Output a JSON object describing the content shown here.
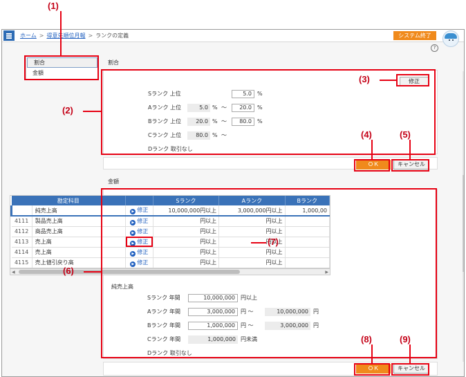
{
  "header": {
    "breadcrumb": [
      {
        "label": "ホーム",
        "link": true
      },
      {
        "label": "得意先順位月報",
        "link": true
      },
      {
        "label": "ランクの定義",
        "link": false
      }
    ],
    "separator": ">",
    "system_exit": "システム終了",
    "help": "?"
  },
  "nav": {
    "items": [
      "割合",
      "金額"
    ],
    "active": 0
  },
  "ratio": {
    "title": "割合",
    "edit": "修正",
    "ok": "ＯＫ",
    "cancel": "キャンセル",
    "unit": "%",
    "tilde": "～",
    "rows": [
      {
        "label": "Sランク 上位",
        "from": null,
        "to": "5.0"
      },
      {
        "label": "Aランク 上位",
        "from": "5.0",
        "to": "20.0"
      },
      {
        "label": "Bランク 上位",
        "from": "20.0",
        "to": "80.0"
      },
      {
        "label": "Cランク 上位",
        "from": "80.0",
        "to": null
      },
      {
        "label": "Dランク 取引なし"
      }
    ]
  },
  "amount": {
    "title": "金額",
    "table": {
      "headers": [
        "勘定科目",
        "Sランク",
        "Aランク",
        "Bランク"
      ],
      "edit_label": "修正",
      "rows": [
        {
          "code": "",
          "name": "純売上高",
          "s": "10,000,000円以上",
          "a": "3,000,000円以上",
          "b": "1,000,00"
        },
        {
          "code": "4111",
          "name": "製品売上高",
          "s": "円以上",
          "a": "円以上",
          "b": ""
        },
        {
          "code": "4112",
          "name": "商品売上高",
          "s": "円以上",
          "a": "円以上",
          "b": ""
        },
        {
          "code": "4113",
          "name": "売上高",
          "s": "円以上",
          "a": "円以上",
          "b": ""
        },
        {
          "code": "4114",
          "name": "売上高",
          "s": "円以上",
          "a": "円以上",
          "b": ""
        },
        {
          "code": "4115",
          "name": "売上値引戻り高",
          "s": "円以上",
          "a": "円以上",
          "b": ""
        }
      ]
    },
    "detail": {
      "title": "純売上高",
      "rows": [
        {
          "label": "Sランク 年間",
          "from": "10,000,000",
          "from_unit": "円以上"
        },
        {
          "label": "Aランク 年間",
          "from": "3,000,000",
          "from_unit": "円 ～",
          "to": "10,000,000",
          "to_unit": "円"
        },
        {
          "label": "Bランク 年間",
          "from": "1,000,000",
          "from_unit": "円 ～",
          "to": "3,000,000",
          "to_unit": "円"
        },
        {
          "label": "Cランク 年間",
          "from": "1,000,000",
          "from_unit": "円未満"
        },
        {
          "label": "Dランク 取引なし"
        }
      ]
    },
    "ok": "ＯＫ",
    "cancel": "キャンセル"
  },
  "annotations": {
    "n1": "(1)",
    "n2": "(2)",
    "n3": "(3)",
    "n4": "(4)",
    "n5": "(5)",
    "n6": "(6)",
    "n7": "(7)",
    "n8": "(8)",
    "n9": "(9)"
  },
  "colors": {
    "accent": "#f08a1c",
    "brand": "#2f6db5",
    "callout": "#e60012",
    "table_header": "#3a72b8"
  }
}
